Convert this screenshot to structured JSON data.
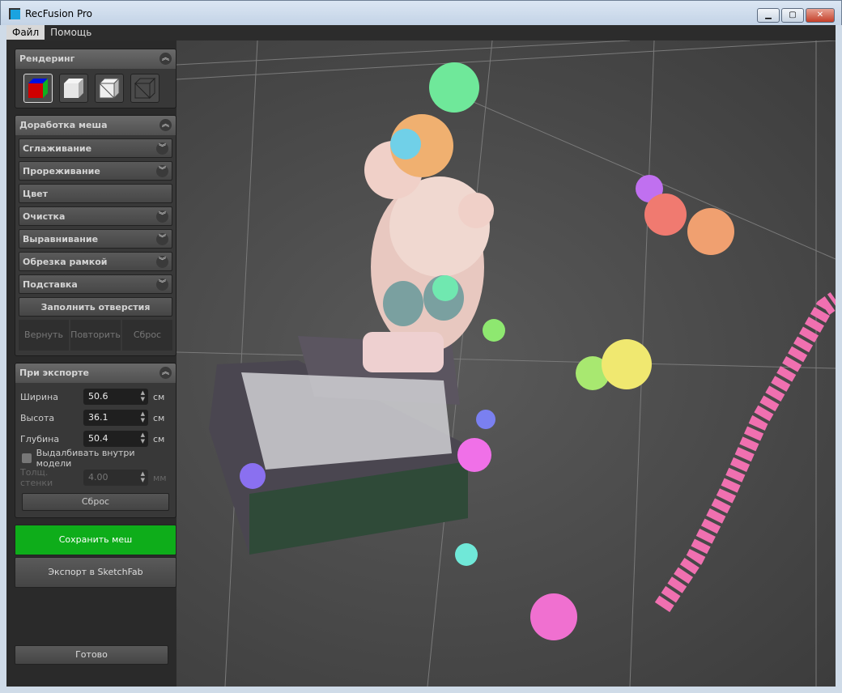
{
  "window": {
    "title": "RecFusion Pro"
  },
  "menu": [
    "Файл",
    "Помощь"
  ],
  "rendering": {
    "title": "Рендеринг"
  },
  "mesh": {
    "title": "Доработка меша",
    "items": [
      "Сглаживание",
      "Прореживание",
      "Цвет",
      "Очистка",
      "Выравнивание",
      "Обрезка рамкой",
      "Подставка"
    ],
    "fill_holes": "Заполнить отверстия",
    "undo": "Вернуть",
    "redo": "Повторить",
    "reset": "Сброс"
  },
  "export": {
    "title": "При экспорте",
    "width_label": "Ширина",
    "width": "50.6",
    "height_label": "Высота",
    "height": "36.1",
    "depth_label": "Глубина",
    "depth": "50.4",
    "unit": "см",
    "hollow_label": "Выдалбивать внутри модели",
    "hollow_checked": false,
    "wall_label": "Толщ. стенки",
    "wall": "4.00",
    "wall_unit": "мм",
    "reset": "Сброс"
  },
  "save_mesh": "Сохранить меш",
  "sketchfab": "Экспорт в SketchFab",
  "done": "Готово"
}
